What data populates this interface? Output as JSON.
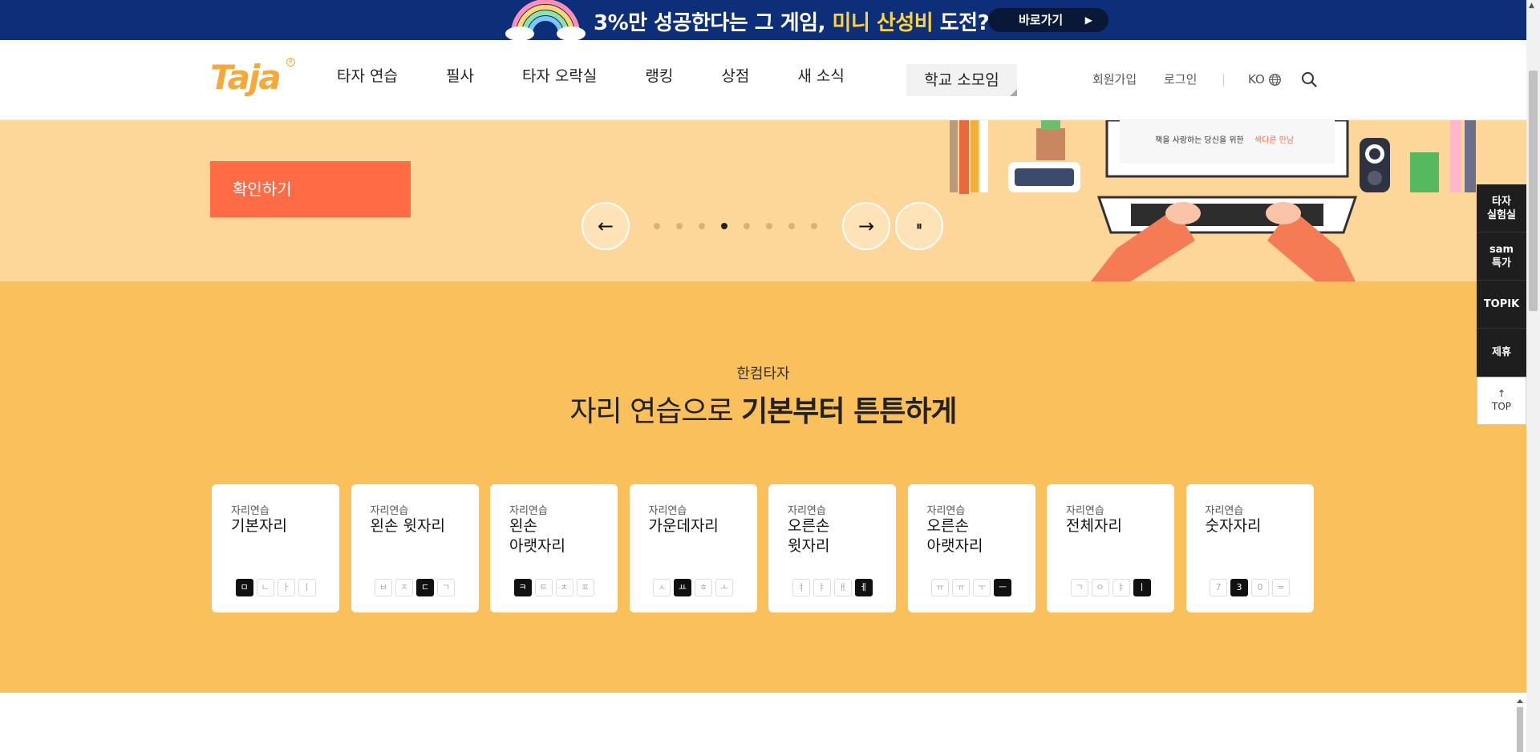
{
  "banner": {
    "text_prefix": "3%만 성공한다는 그 게임,",
    "text_highlight": "미니 산성비",
    "text_suffix": "도전?",
    "cta_label": "바로가기",
    "cta_arrow": "▶"
  },
  "header": {
    "logo": "Taja",
    "logo_reg": "R",
    "nav": [
      "타자 연습",
      "필사",
      "타자 오락실",
      "랭킹",
      "상점",
      "새 소식"
    ],
    "school": "학교 소모임",
    "signup": "회원가입",
    "login": "로그인",
    "lang": "KO"
  },
  "hero": {
    "confirm_label": "확인하기",
    "prev_icon": "←",
    "next_icon": "→",
    "pause_icon": "⏸",
    "slide_count": 8,
    "active_slide": 4,
    "art_text_a": "책을 사랑하는 당신을 위한",
    "art_text_b": "색다른 만남"
  },
  "section": {
    "eyebrow": "한컴타자",
    "headline_plain": "자리 연습으로",
    "headline_bold": "기본부터 튼튼하게",
    "cards": [
      {
        "kicker": "자리연습",
        "title": "기본자리",
        "keys": [
          "ㅁ",
          "ㄴ",
          "ㅏ",
          "ㅣ"
        ],
        "active": 0
      },
      {
        "kicker": "자리연습",
        "title": "왼손 윗자리",
        "keys": [
          "ㅂ",
          "ㅈ",
          "ㄷ",
          "ㄱ"
        ],
        "active": 2
      },
      {
        "kicker": "자리연습",
        "title": "왼손\n아랫자리",
        "keys": [
          "ㅋ",
          "ㅌ",
          "ㅊ",
          "ㅍ"
        ],
        "active": 0
      },
      {
        "kicker": "자리연습",
        "title": "가운데자리",
        "keys": [
          "ㅅ",
          "ㅛ",
          "ㅎ",
          "ㅗ"
        ],
        "active": 1
      },
      {
        "kicker": "자리연습",
        "title": "오른손\n윗자리",
        "keys": [
          "ㅕ",
          "ㅑ",
          "ㅐ",
          "ㅔ"
        ],
        "active": 3
      },
      {
        "kicker": "자리연습",
        "title": "오른손\n아랫자리",
        "keys": [
          "ㅠ",
          "ㅠ",
          "ㅜ",
          "ㅡ"
        ],
        "active": 3
      },
      {
        "kicker": "자리연습",
        "title": "전체자리",
        "keys": [
          "ㄱ",
          "ㅇ",
          "ㅑ",
          "ㅣ"
        ],
        "active": 3
      },
      {
        "kicker": "자리연습",
        "title": "숫자자리",
        "keys": [
          "7",
          "3",
          "0",
          "="
        ],
        "active": 1
      }
    ]
  },
  "side": {
    "items": [
      "타자\n실험실",
      "sam\n특가",
      "TOPIK",
      "제휴"
    ],
    "top_arrow": "↑",
    "top_label": "TOP"
  },
  "colors": {
    "banner_bg": "#0d2f7a",
    "hero_bg": "#fdd69a",
    "section_bg": "#f9c05c",
    "accent": "#ff6b45",
    "brand": "#f5a93b"
  }
}
